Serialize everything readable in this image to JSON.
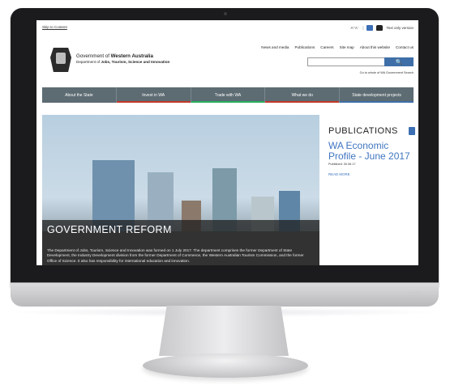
{
  "utility_bar": {
    "skip_link": "Skip to Content",
    "text_size": "A⁺A⁻",
    "text_only": "Text only version"
  },
  "header": {
    "gov_line1_prefix": "Government of ",
    "gov_line1_bold": "Western Australia",
    "gov_line2_prefix": "Department of ",
    "gov_line2_bold": "Jobs, Tourism, Science and Innovation",
    "top_links": [
      "News and media",
      "Publications",
      "Careers",
      "Site map",
      "About this website",
      "Contact us"
    ],
    "search_placeholder": "",
    "search_whole_link": "Go to whole of WA Government Search"
  },
  "main_nav": {
    "items": [
      {
        "label": "About the State",
        "bar_color": "#5d6b73"
      },
      {
        "label": "Invest in WA",
        "bar_color": "#c0392b"
      },
      {
        "label": "Trade with WA",
        "bar_color": "#27ae60"
      },
      {
        "label": "What we do",
        "bar_color": "#c0392b"
      },
      {
        "label": "State development projects",
        "bar_color": "#3f6fa8"
      }
    ]
  },
  "hero": {
    "title": "GOVERNMENT REFORM",
    "text": "The Department of Jobs, Tourism, Science and Innovation was formed on 1 July 2017. The department comprises the former Department of State Development, the Industry Development division from the former Department of Commerce, the Western Australian Tourism Commission, and the former Office of Science. It also has responsibility for international education and innovation."
  },
  "sidebar": {
    "heading": "PUBLICATIONS",
    "title": "WA Economic Profile - June 2017",
    "date": "Published: 30.06.17",
    "read_more": "READ MORE"
  },
  "colors": {
    "accent_blue": "#3f75c0",
    "nav_grey": "#5d6b73",
    "search_blue": "#3f6fa8"
  }
}
